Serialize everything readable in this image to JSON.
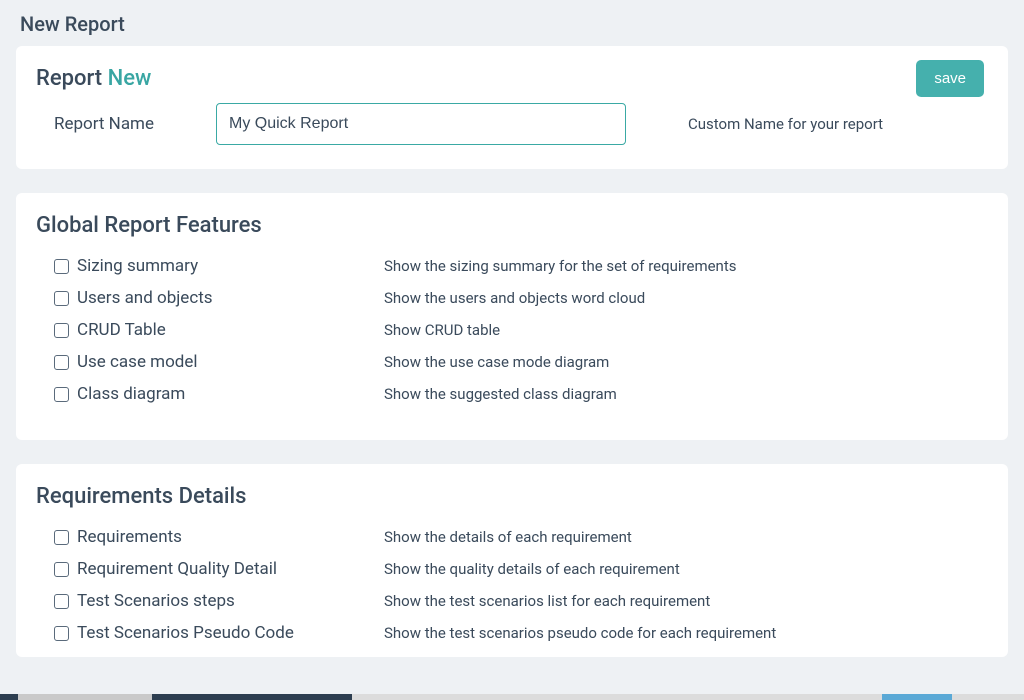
{
  "page": {
    "title": "New Report"
  },
  "reportCard": {
    "title_prefix": "Report",
    "title_badge": "New",
    "name_label": "Report Name",
    "name_value": "My Quick Report",
    "hint": "Custom Name for your report",
    "save_label": "save"
  },
  "globalFeatures": {
    "title": "Global Report Features",
    "items": [
      {
        "label": "Sizing summary",
        "desc": "Show the sizing summary for the set of requirements"
      },
      {
        "label": "Users and objects",
        "desc": "Show the users and objects word cloud"
      },
      {
        "label": "CRUD Table",
        "desc": "Show CRUD table"
      },
      {
        "label": "Use case model",
        "desc": "Show the use case mode diagram"
      },
      {
        "label": "Class diagram",
        "desc": "Show the suggested class diagram"
      }
    ]
  },
  "requirementsDetails": {
    "title": "Requirements Details",
    "items": [
      {
        "label": "Requirements",
        "desc": "Show the details of each requirement"
      },
      {
        "label": "Requirement Quality Detail",
        "desc": "Show the quality details of each requirement"
      },
      {
        "label": "Test Scenarios steps",
        "desc": "Show the test scenarios list for each requirement"
      },
      {
        "label": "Test Scenarios Pseudo Code",
        "desc": "Show the test scenarios pseudo code for each requirement"
      }
    ]
  }
}
